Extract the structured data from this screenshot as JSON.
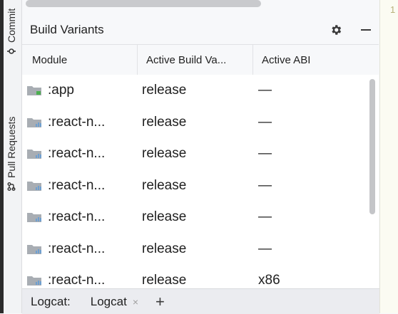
{
  "left_strip": {
    "tabs": [
      {
        "label": "Commit"
      },
      {
        "label": "Pull Requests"
      }
    ]
  },
  "gutter": {
    "line_number": "1"
  },
  "panel": {
    "title": "Build Variants",
    "columns": [
      "Module",
      "Active Build Va...",
      "Active ABI"
    ],
    "rows": [
      {
        "module": ":app",
        "variant": "release",
        "abi": "—",
        "icon": "app-module-folder-icon"
      },
      {
        "module": ":react-n...",
        "variant": "release",
        "abi": "—",
        "icon": "library-module-folder-icon"
      },
      {
        "module": ":react-n...",
        "variant": "release",
        "abi": "—",
        "icon": "library-module-folder-icon"
      },
      {
        "module": ":react-n...",
        "variant": "release",
        "abi": "—",
        "icon": "library-module-folder-icon"
      },
      {
        "module": ":react-n...",
        "variant": "release",
        "abi": "—",
        "icon": "library-module-folder-icon"
      },
      {
        "module": ":react-n...",
        "variant": "release",
        "abi": "—",
        "icon": "library-module-folder-icon"
      },
      {
        "module": ":react-n...",
        "variant": "release",
        "abi": "x86",
        "icon": "library-module-folder-icon"
      }
    ]
  },
  "bottom": {
    "label": "Logcat:",
    "tab": "Logcat",
    "close": "×",
    "add": "+"
  },
  "colors": {
    "accent_green": "#4caf50",
    "folder_gray": "#9aa0a6"
  }
}
